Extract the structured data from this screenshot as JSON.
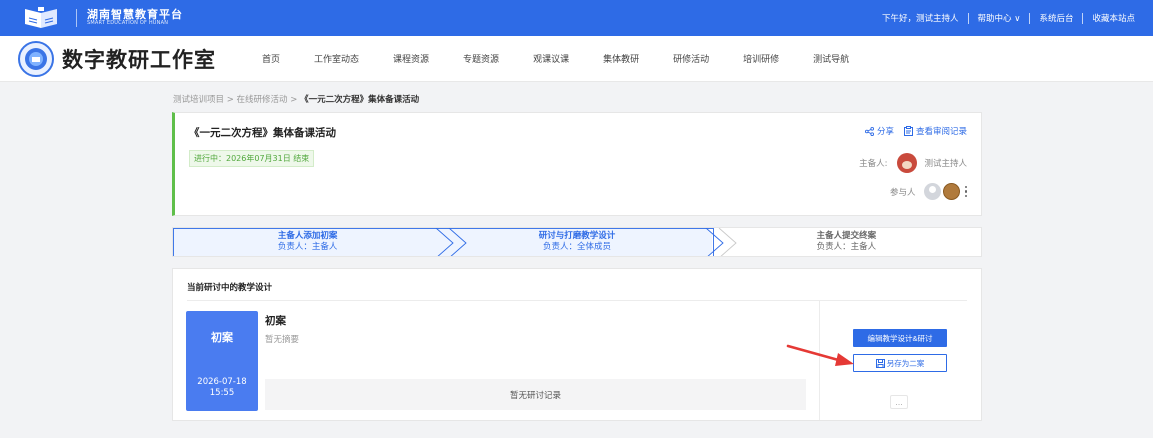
{
  "topbar": {
    "brand_cn": "湖南智慧教育平台",
    "brand_en": "SMART EDUCATION OF HUNAN",
    "greeting": "下午好，测试主持人",
    "help": "帮助中心 ∨",
    "admin": "系统后台",
    "favorite": "收藏本站点",
    "bg_color": "#2e6be6"
  },
  "navbar": {
    "site_title": "数字教研工作室",
    "items": [
      "首页",
      "工作室动态",
      "课程资源",
      "专题资源",
      "观课议课",
      "集体教研",
      "研修活动",
      "培训研修",
      "测试导航"
    ]
  },
  "breadcrumb": {
    "level1": "测试培训项目",
    "level2": "在线研修活动",
    "current": "《一元二次方程》集体备课活动"
  },
  "activity": {
    "title": "《一元二次方程》集体备课活动",
    "status": "进行中：2026年07月31日 结束",
    "share_label": "分享",
    "review_label": "查看审阅记录",
    "host_label": "主备人:",
    "host_name": "测试主持人",
    "participants_label": "参与人",
    "accent_color": "#5fbf4a"
  },
  "steps": [
    {
      "name": "主备人添加初案",
      "owner": "负责人：主备人",
      "state": "active"
    },
    {
      "name": "研讨与打磨教学设计",
      "owner": "负责人：全体成员",
      "state": "active"
    },
    {
      "name": "主备人提交终案",
      "owner": "负责人：主备人",
      "state": "inactive"
    }
  ],
  "design": {
    "section_title": "当前研讨中的教学设计",
    "tag": "初案",
    "date": "2026-07-18",
    "time": "15:55",
    "name": "初案",
    "abstract": "暂无摘要",
    "no_record": "暂无研讨记录",
    "edit_button": "编辑教学设计&研讨",
    "save_as_button": "另存为二案",
    "more_button": "..."
  }
}
